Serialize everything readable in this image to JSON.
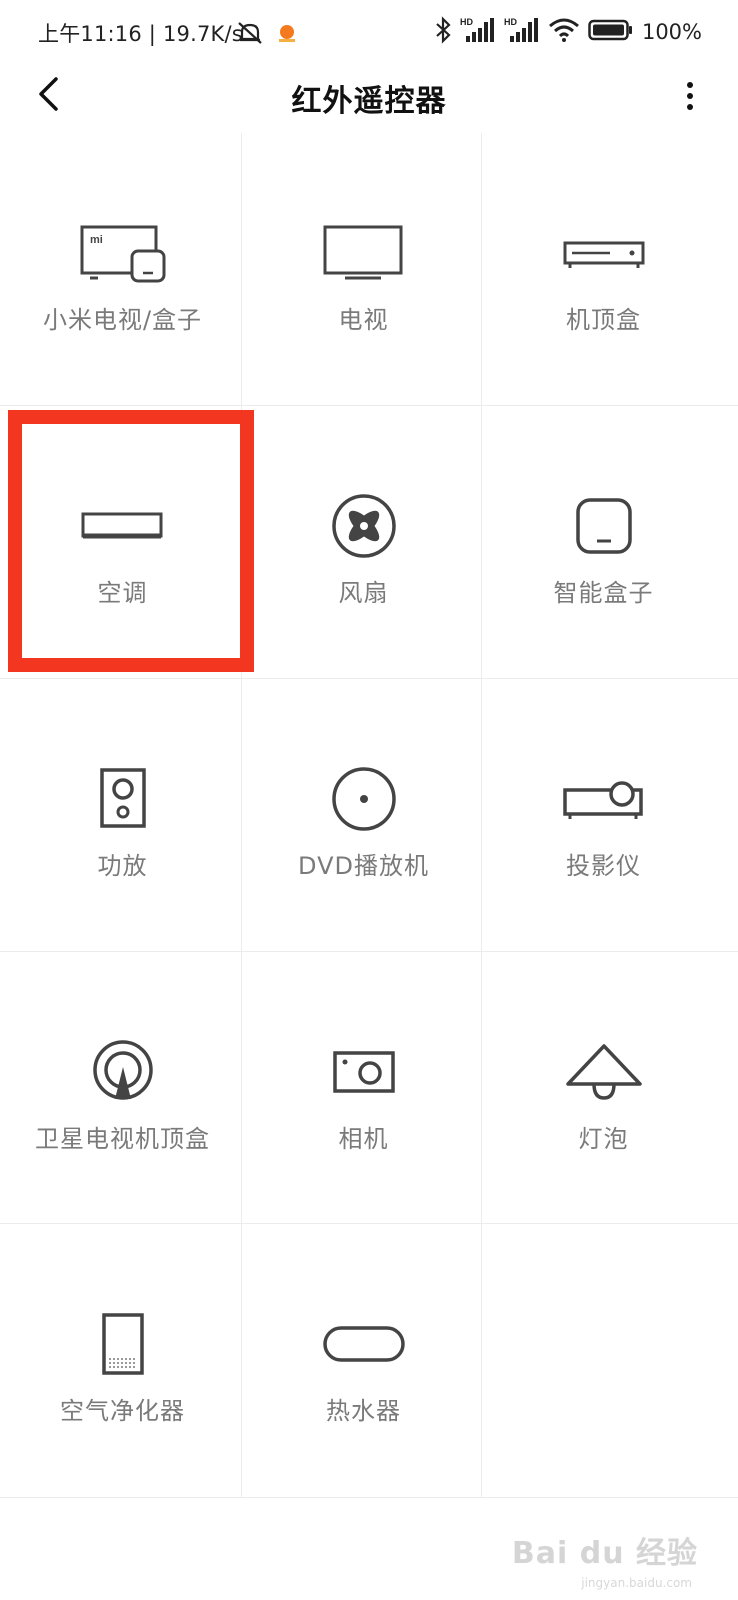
{
  "status_bar": {
    "time_speed": "上午11:16 | 19.7K/s",
    "battery": "100%"
  },
  "header": {
    "title": "红外遥控器"
  },
  "devices": [
    {
      "label": "小米电视/盒子",
      "icon": "mi-tv-box-icon"
    },
    {
      "label": "电视",
      "icon": "tv-icon"
    },
    {
      "label": "机顶盒",
      "icon": "set-top-box-icon"
    },
    {
      "label": "空调",
      "icon": "air-conditioner-icon"
    },
    {
      "label": "风扇",
      "icon": "fan-icon"
    },
    {
      "label": "智能盒子",
      "icon": "smart-box-icon"
    },
    {
      "label": "功放",
      "icon": "amplifier-icon"
    },
    {
      "label": "DVD播放机",
      "icon": "dvd-icon"
    },
    {
      "label": "投影仪",
      "icon": "projector-icon"
    },
    {
      "label": "卫星电视机顶盒",
      "icon": "satellite-icon"
    },
    {
      "label": "相机",
      "icon": "camera-icon"
    },
    {
      "label": "灯泡",
      "icon": "lamp-icon"
    },
    {
      "label": "空气净化器",
      "icon": "air-purifier-icon"
    },
    {
      "label": "热水器",
      "icon": "water-heater-icon"
    }
  ],
  "highlight_color": "#f3361f",
  "watermark": {
    "text": "Bai du 经验",
    "sub": "jingyan.baidu.com"
  }
}
